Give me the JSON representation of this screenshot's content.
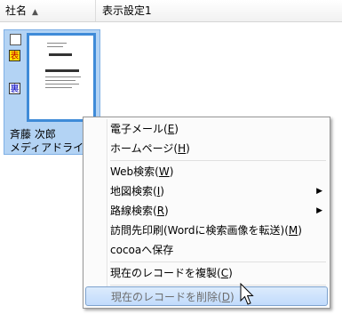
{
  "columns": [
    {
      "label": "社名",
      "sort": "▲"
    },
    {
      "label": "表示設定1"
    }
  ],
  "card": {
    "badge_front": "表",
    "badge_back": "裏",
    "name": "斉藤 次郎",
    "company": "メディアドライブ株式会社"
  },
  "menu": {
    "items": [
      {
        "label": "電子メール(",
        "key": "E",
        "close": ")"
      },
      {
        "label": "ホームページ(",
        "key": "H",
        "close": ")"
      },
      {
        "label": "Web検索(",
        "key": "W",
        "close": ")"
      },
      {
        "label": "地図検索(",
        "key": "I",
        "close": ")",
        "submenu": "▶"
      },
      {
        "label": "路線検索(",
        "key": "R",
        "close": ")",
        "submenu": "▶"
      },
      {
        "label": "訪問先印刷(Wordに検索画像を転送)(",
        "key": "M",
        "close": ")"
      },
      {
        "label": "cocoaへ保存"
      },
      {
        "label": "現在のレコードを複製(",
        "key": "C",
        "close": ")"
      },
      {
        "label": "現在のレコードを削除(",
        "key": "D",
        "close": ")"
      }
    ]
  }
}
